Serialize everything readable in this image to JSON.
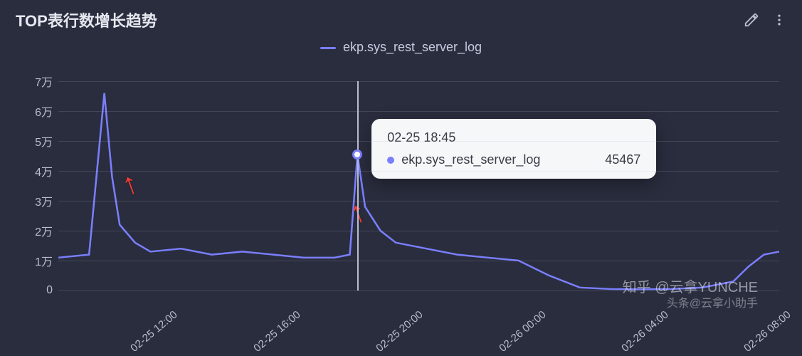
{
  "header": {
    "title": "TOP表行数增长趋势"
  },
  "legend": {
    "series_label": "ekp.sys_rest_server_log"
  },
  "tooltip": {
    "time": "02-25 18:45",
    "series": "ekp.sys_rest_server_log",
    "value": "45467"
  },
  "watermark": {
    "line1": "知乎 @云拿YUNCHE",
    "line2": "头条@云拿小助手"
  },
  "chart_data": {
    "type": "line",
    "title": "TOP表行数增长趋势",
    "xlabel": "",
    "ylabel": "",
    "ylim": [
      0,
      70000
    ],
    "y_ticks": [
      "0",
      "1万",
      "2万",
      "3万",
      "4万",
      "5万",
      "6万",
      "7万"
    ],
    "x_ticks": [
      "02-25 12:00",
      "02-25 16:00",
      "02-25 20:00",
      "02-26 00:00",
      "02-26 04:00",
      "02-26 08:00"
    ],
    "series": [
      {
        "name": "ekp.sys_rest_server_log",
        "color": "#7a7fff",
        "x": [
          "02-25 09:00",
          "02-25 10:00",
          "02-25 10:30",
          "02-25 10:45",
          "02-25 11:00",
          "02-25 11:30",
          "02-25 12:00",
          "02-25 13:00",
          "02-25 14:00",
          "02-25 15:00",
          "02-25 16:00",
          "02-25 17:00",
          "02-25 18:00",
          "02-25 18:30",
          "02-25 18:45",
          "02-25 19:00",
          "02-25 19:30",
          "02-25 20:00",
          "02-25 21:00",
          "02-25 22:00",
          "02-25 23:00",
          "02-26 00:00",
          "02-26 01:00",
          "02-26 02:00",
          "02-26 03:00",
          "02-26 04:00",
          "02-26 05:00",
          "02-26 06:00",
          "02-26 07:00",
          "02-26 07:30",
          "02-26 08:00",
          "02-26 08:30"
        ],
        "values": [
          11000,
          12000,
          66000,
          38000,
          22000,
          16000,
          13000,
          14000,
          12000,
          13000,
          12000,
          11000,
          11000,
          12000,
          45467,
          28000,
          20000,
          16000,
          14000,
          12000,
          11000,
          10000,
          5000,
          1000,
          500,
          400,
          500,
          1000,
          3000,
          8000,
          12000,
          13000
        ]
      }
    ],
    "highlight": {
      "x": "02-25 18:45",
      "y": 45467
    },
    "annotations": [
      "↑",
      "↑"
    ]
  }
}
